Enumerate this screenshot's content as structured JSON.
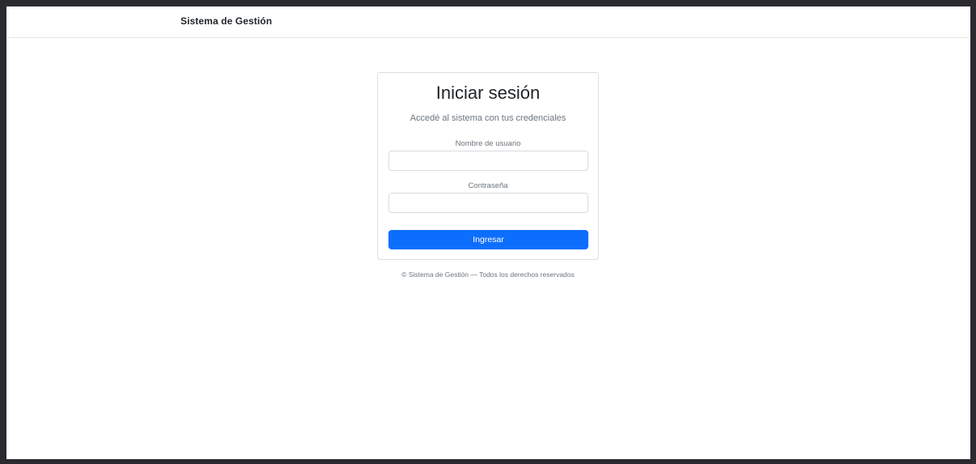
{
  "navbar": {
    "brand": "Sistema de Gestión"
  },
  "login": {
    "title": "Iniciar sesión",
    "subtitle": "Accedé al sistema con tus credenciales",
    "username_label": "Nombre de usuario",
    "username_value": "",
    "password_label": "Contraseña",
    "password_value": "",
    "submit_label": "Ingresar"
  },
  "footer": {
    "text": "© Sistema de Gestión — Todos los derechos reservados"
  },
  "colors": {
    "primary": "#0d6efd",
    "muted_text": "#6c757d",
    "body_text": "#212529"
  }
}
